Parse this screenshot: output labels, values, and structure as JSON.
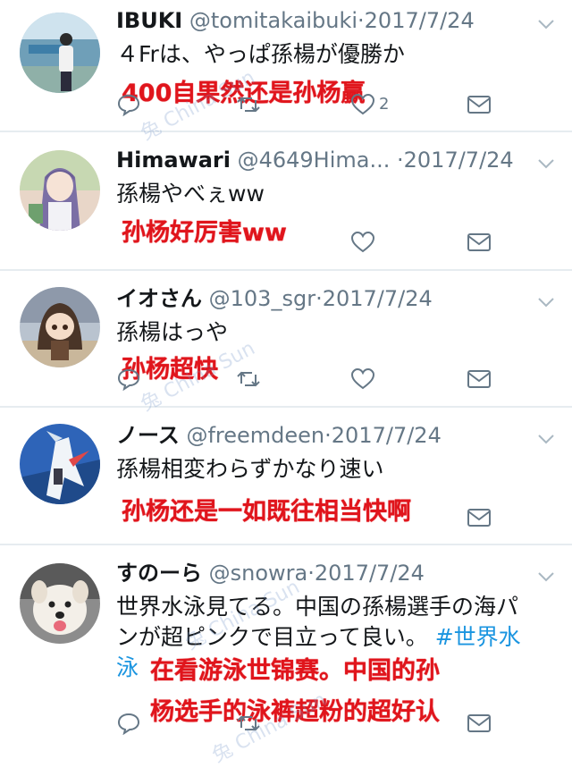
{
  "tweets": [
    {
      "name": "IBUKI",
      "handle": "@tomitakaibuki",
      "date": "2017/7/24",
      "text": "４Frは、やっぱ孫楊が優勝か",
      "translation": "400自果然还是孙杨赢",
      "like_count": "2"
    },
    {
      "name": "Himawari",
      "handle": "@4649Hima...",
      "date": "2017/7/24",
      "text": "孫楊やべぇww",
      "translation": "孙杨好厉害ww"
    },
    {
      "name": "イオさん",
      "handle": "@103_sgr",
      "date": "2017/7/24",
      "text": "孫楊はっや",
      "translation": "孙杨超快"
    },
    {
      "name": "ノース",
      "handle": "@freemdeen",
      "date": "2017/7/24",
      "text": "孫楊相変わらずかなり速い",
      "translation": "孙杨还是一如既往相当快啊"
    },
    {
      "name": "すのーら",
      "handle": "@snowra",
      "date": "2017/7/24",
      "text_line1": "世界水泳見てる。中国の孫楊選手の海パ",
      "text_line2": "ンが超ピンクで目立って良い。",
      "hashtag_part1": "#世界水",
      "hashtag_part2": "泳",
      "translation_line1": "在看游泳世锦赛。中国的孙",
      "translation_line2": "杨选手的泳裤超粉的超好认"
    }
  ],
  "separator": "·",
  "watermark": "兔 China Sun",
  "colors": {
    "name": "#14171a",
    "meta": "#657786",
    "icon": "#657786",
    "hashtag": "#1b95e0",
    "translation": "#e0151c",
    "divider": "#e6ecf0"
  }
}
